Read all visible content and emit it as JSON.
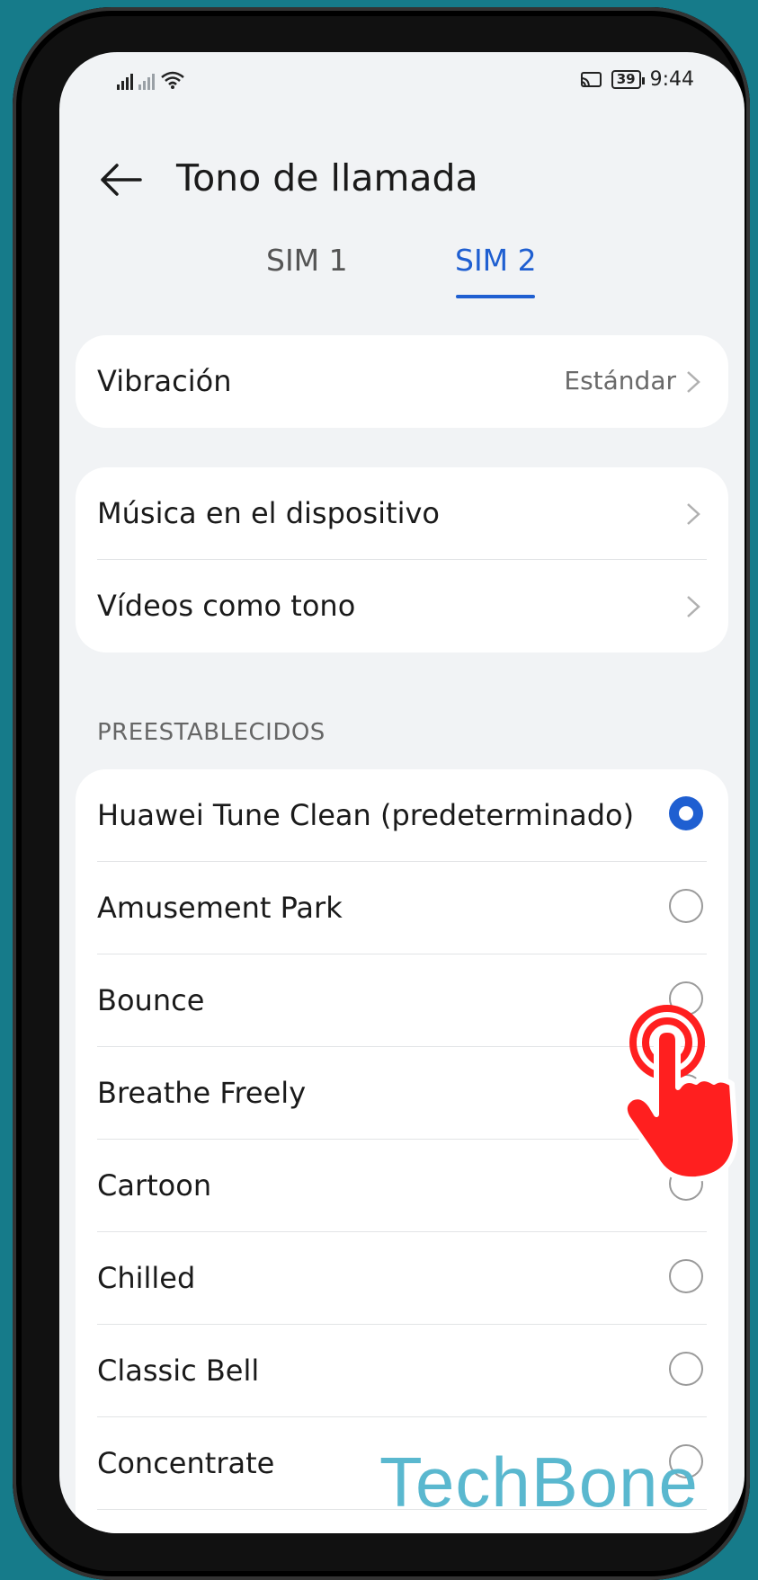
{
  "status_bar": {
    "time": "9:44",
    "battery": "39",
    "signal_icons": [
      "signal-icon",
      "no-signal-icon",
      "wifi-icon",
      "cast-icon"
    ]
  },
  "header": {
    "title": "Tono de llamada",
    "back_icon": "back-arrow-icon"
  },
  "tabs": [
    {
      "label": "SIM 1",
      "selected": false
    },
    {
      "label": "SIM 2",
      "selected": true
    }
  ],
  "vibration": {
    "label": "Vibración",
    "value": "Estándar"
  },
  "sources": [
    {
      "label": "Música en el dispositivo"
    },
    {
      "label": "Vídeos como tono"
    }
  ],
  "presets": {
    "heading": "PREESTABLECIDOS",
    "items": [
      {
        "label": "Huawei Tune Clean (predeterminado)",
        "selected": true
      },
      {
        "label": "Amusement Park",
        "selected": false
      },
      {
        "label": "Bounce",
        "selected": false
      },
      {
        "label": "Breathe Freely",
        "selected": false
      },
      {
        "label": "Cartoon",
        "selected": false
      },
      {
        "label": "Chilled",
        "selected": false
      },
      {
        "label": "Classic Bell",
        "selected": false
      },
      {
        "label": "Concentrate",
        "selected": false
      }
    ]
  },
  "watermark": "TechBone",
  "colors": {
    "accent": "#1f5fd1",
    "background": "#167b8a",
    "hand": "#ff1f1f"
  }
}
